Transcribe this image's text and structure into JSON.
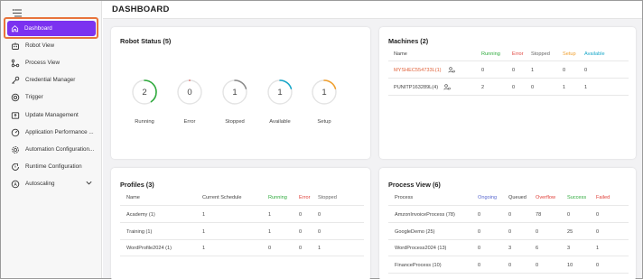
{
  "page_title": "DASHBOARD",
  "sidebar": {
    "items": [
      {
        "label": "Dashboard",
        "icon": "home-icon"
      },
      {
        "label": "Robot View",
        "icon": "robot-icon"
      },
      {
        "label": "Process View",
        "icon": "process-icon"
      },
      {
        "label": "Credential Manager",
        "icon": "key-icon"
      },
      {
        "label": "Trigger",
        "icon": "trigger-icon"
      },
      {
        "label": "Update Management",
        "icon": "update-icon"
      },
      {
        "label": "Application Performance ...",
        "icon": "performance-icon"
      },
      {
        "label": "Automation Configuration...",
        "icon": "gear-icon"
      },
      {
        "label": "Runtime Configuration",
        "icon": "runtime-icon"
      },
      {
        "label": "Autoscaling",
        "icon": "autoscaling-icon"
      }
    ]
  },
  "robot_status": {
    "title": "Robot Status (5)",
    "gauges": [
      {
        "label": "Running",
        "value": "2",
        "fraction": 0.4,
        "color": "#2eaa3c"
      },
      {
        "label": "Error",
        "value": "0",
        "fraction": 0.0,
        "color": "#e0403a"
      },
      {
        "label": "Stopped",
        "value": "1",
        "fraction": 0.2,
        "color": "#8c8c8c"
      },
      {
        "label": "Available",
        "value": "1",
        "fraction": 0.2,
        "color": "#19a7c9"
      },
      {
        "label": "Setup",
        "value": "1",
        "fraction": 0.2,
        "color": "#f0a030"
      }
    ]
  },
  "machines": {
    "title": "Machines (2)",
    "headers": [
      "Name",
      "Running",
      "Error",
      "Stopped",
      "Setup",
      "Available"
    ],
    "rows": [
      {
        "name": "MYSHEC554733L(1)",
        "values": [
          "0",
          "0",
          "1",
          "0",
          "0"
        ]
      },
      {
        "name": "PUNITP163289L(4)",
        "values": [
          "2",
          "0",
          "0",
          "1",
          "1"
        ]
      }
    ]
  },
  "profiles": {
    "title": "Profiles (3)",
    "headers": [
      "Name",
      "Current Schedule",
      "Running",
      "Error",
      "Stopped"
    ],
    "rows": [
      [
        "Academy (1)",
        "1",
        "1",
        "0",
        "0"
      ],
      [
        "Training (1)",
        "1",
        "1",
        "0",
        "0"
      ],
      [
        "WordProfile2024 (1)",
        "1",
        "0",
        "0",
        "1"
      ]
    ]
  },
  "process_view": {
    "title": "Process View (6)",
    "headers": [
      "Process",
      "Ongoing",
      "Queued",
      "Overflow",
      "Success",
      "Failed"
    ],
    "rows": [
      [
        "AmzonInvoiceProcess (78)",
        "0",
        "0",
        "78",
        "0",
        "0"
      ],
      [
        "GoogleDemo (25)",
        "0",
        "0",
        "0",
        "25",
        "0"
      ],
      [
        "WordProcess2024 (13)",
        "0",
        "3",
        "6",
        "3",
        "1"
      ],
      [
        "FinanceProcess (10)",
        "0",
        "0",
        "0",
        "10",
        "0"
      ]
    ]
  },
  "colors": {
    "accent": "#7b32f0",
    "highlight_border": "#e8743c",
    "running": "#2eaa3c",
    "error": "#e0403a",
    "stopped": "#8c8c8c",
    "setup": "#f0a030",
    "available": "#19a7c9",
    "ongoing": "#5b6ad0",
    "overflow": "#e0403a",
    "success": "#2eaa3c",
    "failed": "#e0403a",
    "machine_warning": "#e0623a"
  }
}
